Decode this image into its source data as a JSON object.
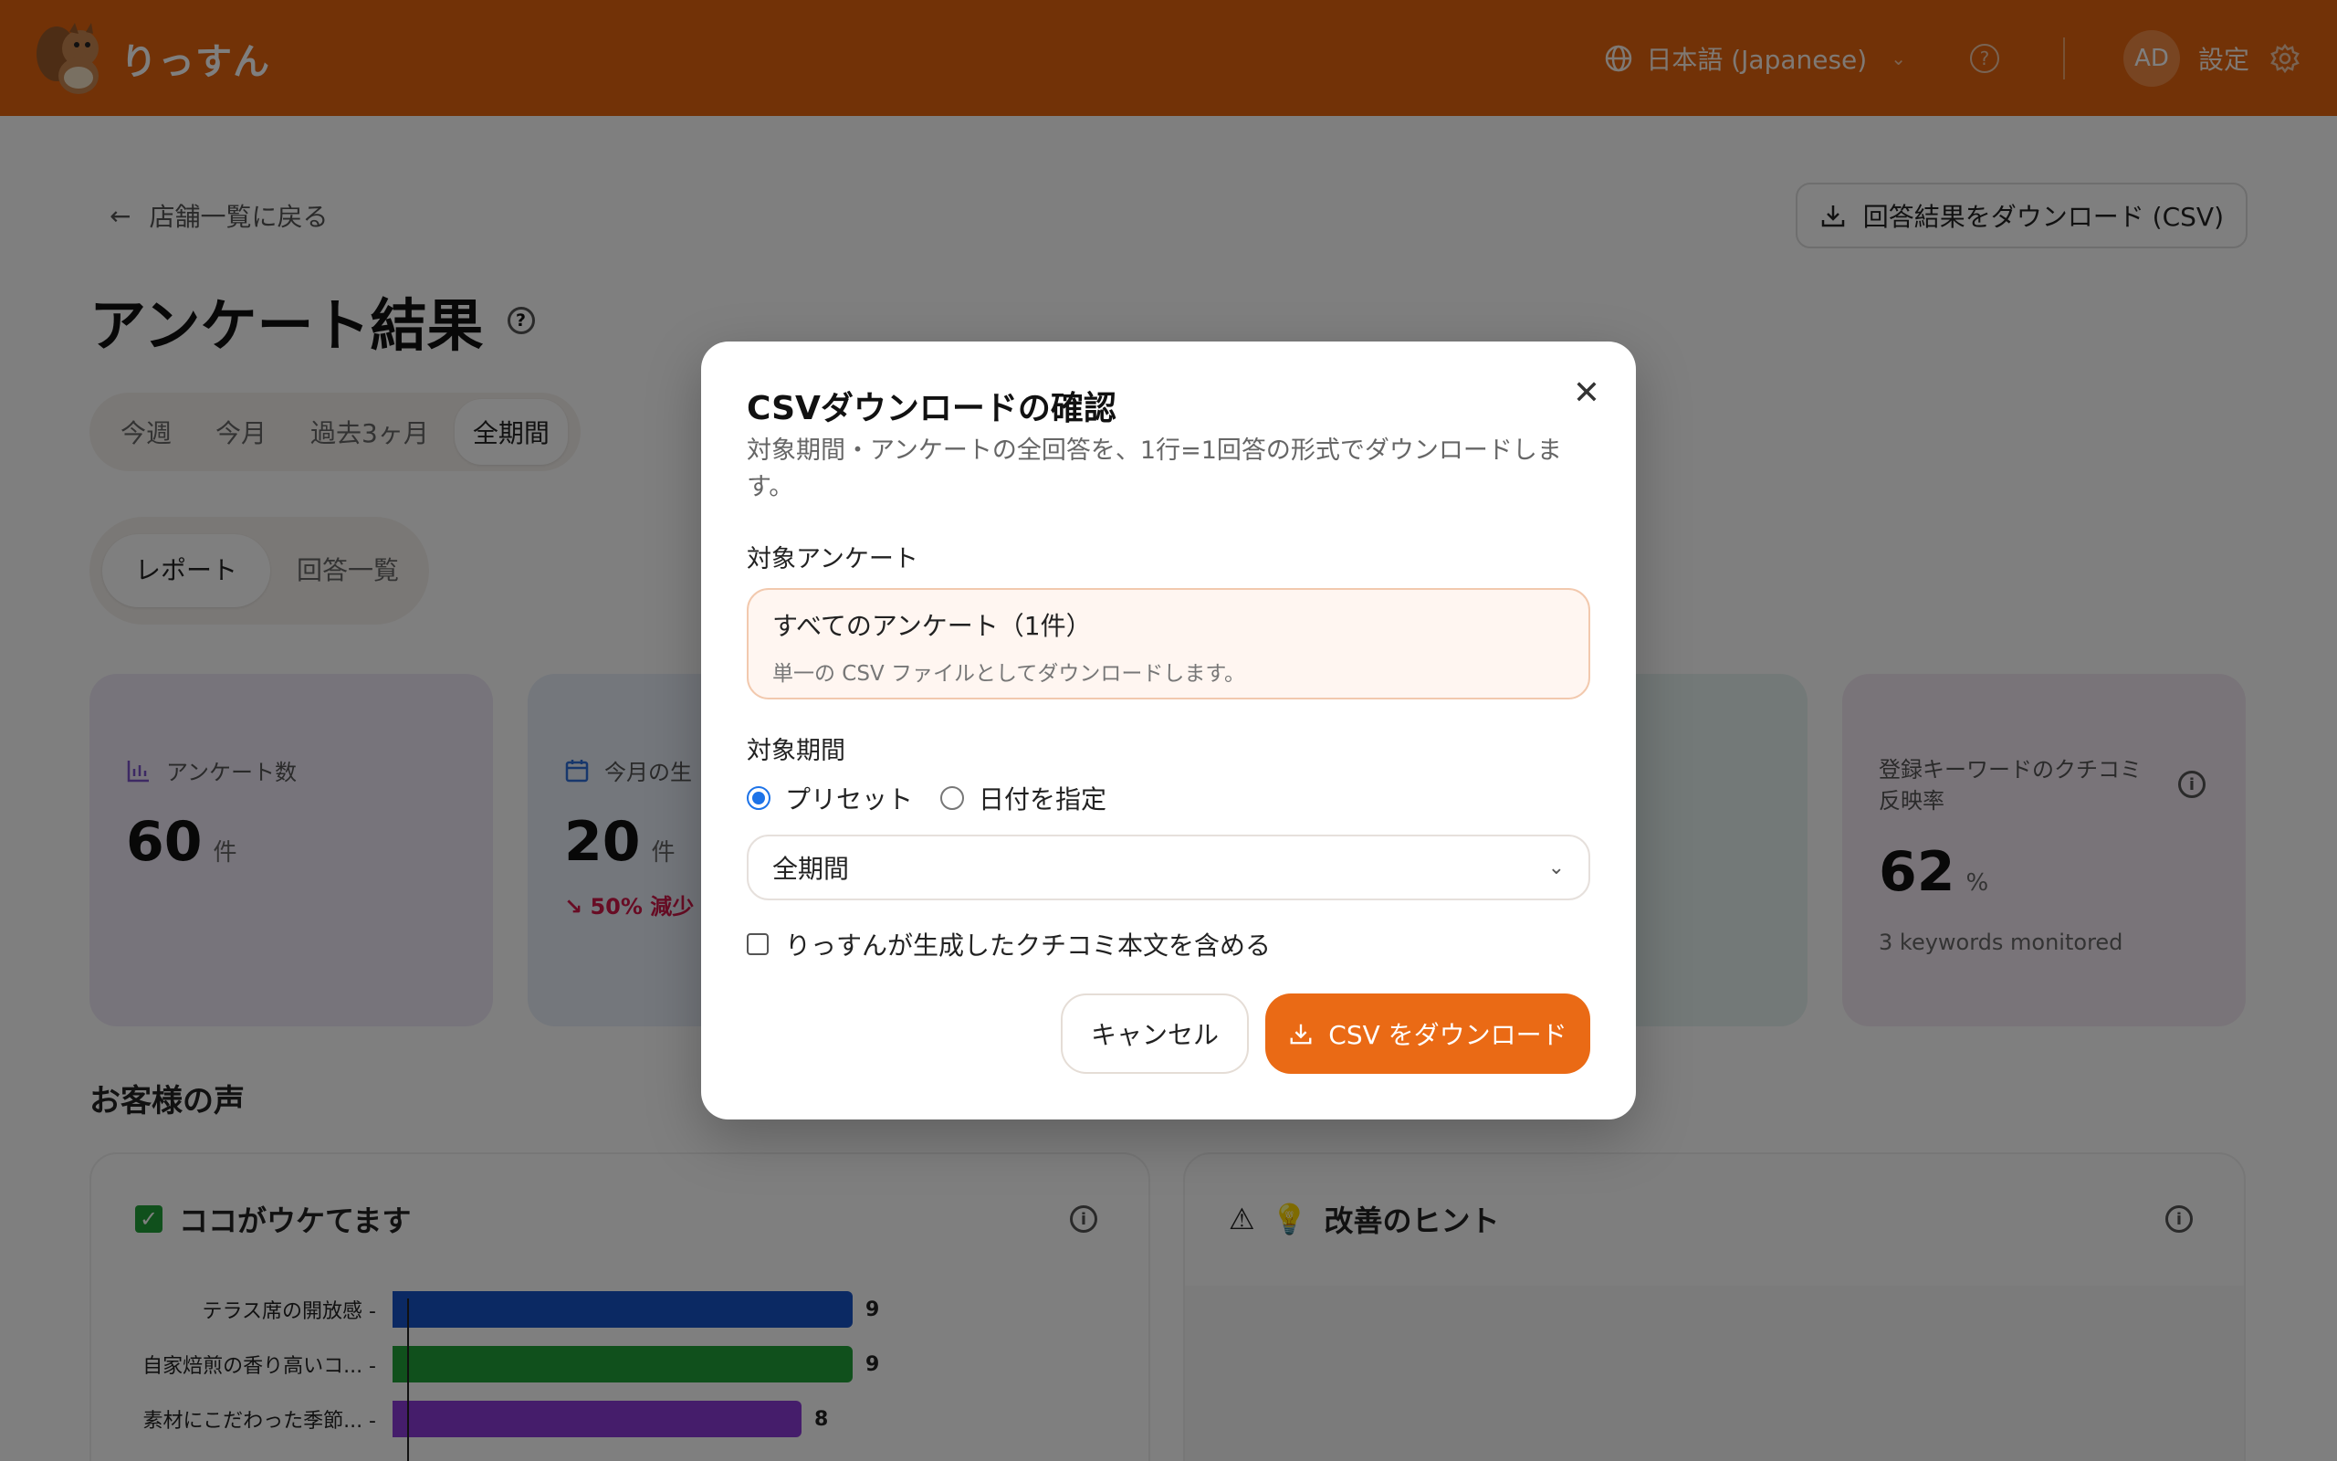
{
  "header": {
    "logo_text": "りっすん",
    "language": "日本語 (Japanese)",
    "avatar_initials": "AD",
    "settings_label": "設定"
  },
  "page": {
    "back_label": "店舗一覧に戻る",
    "download_button": "回答結果をダウンロード (CSV)",
    "title": "アンケート結果",
    "period_tabs": [
      "今週",
      "今月",
      "過去3ヶ月",
      "全期間"
    ],
    "view_tabs": [
      "レポート",
      "回答一覧"
    ],
    "cards": [
      {
        "label": "アンケート数",
        "value": "60",
        "unit": "件"
      },
      {
        "label": "今月の生",
        "value": "20",
        "unit": "件",
        "trend": "50% 減少"
      },
      {
        "label": "登録キーワードのクチコミ反映率",
        "value": "62",
        "unit": "%",
        "sub": "3 keywords monitored"
      }
    ],
    "section_title": "お客様の声",
    "panel_left_title": "ココがウケてます",
    "panel_right_title": "改善のヒント"
  },
  "chart_data": {
    "type": "bar",
    "categories": [
      "テラス席の開放感",
      "自家焙煎の香り高いコ...",
      "素材にこだわった季節..."
    ],
    "values": [
      9,
      9,
      8
    ],
    "colors": [
      "#1753c6",
      "#21a038",
      "#8b3ad6"
    ],
    "xlim": [
      0,
      9
    ]
  },
  "modal": {
    "title": "CSVダウンロードの確認",
    "description": "対象期間・アンケートの全回答を、1行=1回答の形式でダウンロードします。",
    "survey_label": "対象アンケート",
    "survey_main": "すべてのアンケート（1件）",
    "survey_sub": "単一の CSV ファイルとしてダウンロードします。",
    "period_label": "対象期間",
    "radio_preset": "プリセット",
    "radio_date": "日付を指定",
    "select_value": "全期間",
    "checkbox_label": "りっすんが生成したクチコミ本文を含める",
    "cancel": "キャンセル",
    "download": "CSV をダウンロード"
  }
}
